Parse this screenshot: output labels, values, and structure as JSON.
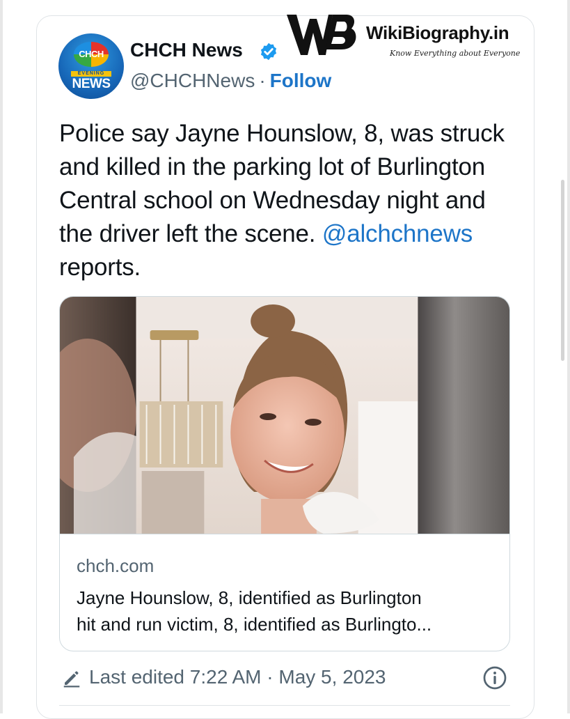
{
  "tweet": {
    "author": {
      "name": "CHCH News",
      "handle": "@CHCHNews",
      "separator": "·",
      "follow_label": "Follow",
      "verified": true,
      "avatar": {
        "logo_text": "CHCH",
        "banner_text": "EVENING",
        "news_text": "NEWS"
      }
    },
    "text": {
      "before_mention": "Police say Jayne Hounslow, 8, was struck and killed in the parking lot of Burlington Central school on Wednesday night and the driver left the scene. ",
      "mention": "@alchchnews",
      "after_mention": " reports."
    },
    "link_card": {
      "domain": "chch.com",
      "description_lines": [
        "Jayne Hounslow, 8, identified as Burlington",
        "hit and run victim, 8, identified as Burlingto..."
      ]
    },
    "footer": {
      "last_edited": "Last edited 7:22 AM · May 5, 2023"
    }
  },
  "watermark": {
    "name": "WikiBiography.in",
    "tagline": "Know Everything about Everyone"
  },
  "colors": {
    "link": "#1d75c8",
    "verified": "#1d9bf0",
    "secondary_text": "#536471",
    "border": "#cfd9de"
  },
  "icons": [
    "verified-badge-icon",
    "pencil-edit-icon",
    "info-icon",
    "wb-logo-icon"
  ]
}
